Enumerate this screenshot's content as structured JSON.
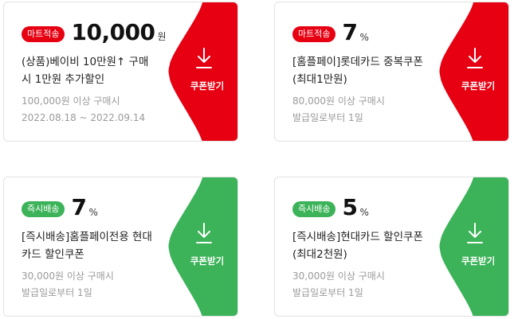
{
  "colors": {
    "red": "#e60012",
    "green": "#3cb359"
  },
  "coupons": [
    {
      "badge": "마트적송",
      "value": "10,000",
      "unit": "원",
      "title_line1": "(상품)베이비 10만원↑ 구매",
      "title_line2": "시 1만원 추가할인",
      "condition": "100,000원 이상 구매시",
      "period": "2022.08.18 ~ 2022.09.14",
      "button_label": "쿠폰받기",
      "theme": "red"
    },
    {
      "badge": "마트적송",
      "value": "7",
      "unit": "%",
      "title_line1": "[홈플페이]롯데카드 중복쿠폰",
      "title_line2": "(최대1만원)",
      "condition": "80,000원 이상 구매시",
      "period": "발급일로부터 1일",
      "button_label": "쿠폰받기",
      "theme": "red"
    },
    {
      "badge": "즉시배송",
      "value": "7",
      "unit": "%",
      "title_line1": "[즉시배송]홈플페이전용 현대",
      "title_line2": "카드 할인쿠폰",
      "condition": "30,000원 이상 구매시",
      "period": "발급일로부터 1일",
      "button_label": "쿠폰받기",
      "theme": "green"
    },
    {
      "badge": "즉시배송",
      "value": "5",
      "unit": "%",
      "title_line1": "[즉시배송]현대카드 할인쿠폰",
      "title_line2": "(최대2천원)",
      "condition": "30,000원 이상 구매시",
      "period": "발급일로부터 1일",
      "button_label": "쿠폰받기",
      "theme": "green"
    }
  ],
  "icon": "download-icon"
}
